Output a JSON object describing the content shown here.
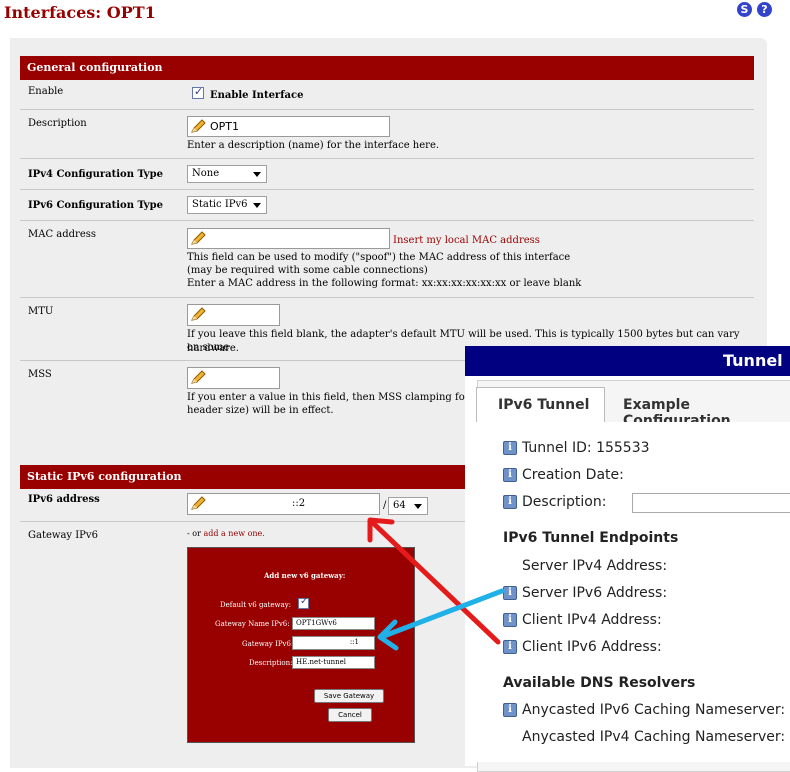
{
  "page": {
    "title": "Interfaces: OPT1",
    "icons": [
      "status-icon",
      "help-icon"
    ],
    "icon_glyphs": {
      "status": "S",
      "help": "?"
    }
  },
  "colors": {
    "header": "#990000",
    "panel": "#eeeeee",
    "tunnel_bar": "#000080",
    "arrow_red": "#e51b1b",
    "arrow_blue": "#1fb1e8"
  },
  "general": {
    "heading": "General configuration",
    "enable": {
      "label": "Enable",
      "checkbox_label": "Enable Interface",
      "checked": true
    },
    "description": {
      "label": "Description",
      "value": "OPT1",
      "help": "Enter a description (name) for the interface here."
    },
    "ipv4_type": {
      "label": "IPv4 Configuration Type",
      "value": "None"
    },
    "ipv6_type": {
      "label": "IPv6 Configuration Type",
      "value": "Static IPv6"
    },
    "mac": {
      "label": "MAC address",
      "value": "",
      "link": "Insert my local MAC address",
      "help": [
        "This field can be used to modify (\"spoof\") the MAC address of this interface",
        "(may be required with some cable connections)",
        "Enter a MAC address in the following format: xx:xx:xx:xx:xx:xx or leave blank"
      ]
    },
    "mtu": {
      "label": "MTU",
      "value": "",
      "help": [
        "If you leave this field blank, the adapter's default MTU will be used. This is typically 1500 bytes but can vary on some",
        "hardware."
      ]
    },
    "mss": {
      "label": "MSS",
      "value": "",
      "help": [
        "If you enter a value in this field, then MSS clamping for TC",
        "header size) will be in effect."
      ]
    }
  },
  "static_ipv6": {
    "heading": "Static IPv6 configuration",
    "address": {
      "label": "IPv6 address",
      "value": "::2",
      "slash": "/",
      "prefix": "64"
    },
    "gateway": {
      "label": "Gateway IPv6",
      "hint_prefix": "- or ",
      "hint_link": "add a new one.",
      "popup": {
        "title": "Add new v6 gateway:",
        "default_label": "Default v6 gateway:",
        "default_checked": true,
        "name_label": "Gateway Name IPv6:",
        "name_value": "OPT1GWv6",
        "ip_label": "Gateway IPv6:",
        "ip_value": "::1",
        "desc_label": "Description:",
        "desc_value": "HE.net-tunnel",
        "save": "Save Gateway",
        "cancel": "Cancel"
      }
    }
  },
  "tunnel": {
    "title": "Tunnel",
    "tabs": [
      "IPv6 Tunnel",
      "Example Configuration"
    ],
    "rows": {
      "tunnel_id": "Tunnel ID: 155533",
      "creation": "Creation Date:",
      "description": "Description:",
      "endpoints": "IPv6 Tunnel Endpoints",
      "server_v4": "Server IPv4 Address:",
      "server_v6": "Server IPv6 Address:",
      "client_v4": "Client IPv4 Address:",
      "client_v6": "Client IPv6 Address:",
      "dns": "Available DNS Resolvers",
      "anycast_v6": "Anycasted IPv6 Caching Nameserver:",
      "anycast_v4": "Anycasted IPv4 Caching Nameserver:"
    },
    "info_glyph": "i"
  }
}
